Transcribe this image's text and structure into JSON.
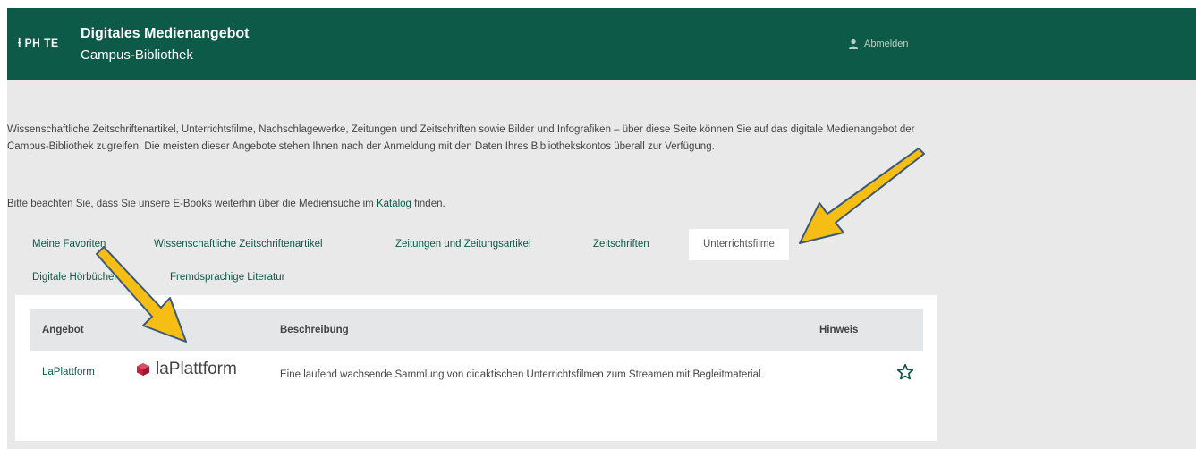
{
  "header": {
    "logo": "PH TE",
    "title": "Digitales Medienangebot",
    "subtitle": "Campus-Bibliothek",
    "logout_label": "Abmelden",
    "logout_icon": "user-icon"
  },
  "intro": {
    "text": "Wissenschaftliche Zeitschriftenartikel, Unterrichtsfilme, Nachschlagewerke, Zeitungen und Zeitschriften sowie Bilder und Infografiken – über diese Seite können Sie auf das digitale Medienangebot der Campus-Bibliothek zugreifen. Die meisten dieser Angebote stehen Ihnen nach der Anmeldung mit den Daten Ihres Bibliothekskontos überall zur Verfügung.",
    "note_before": "Bitte beachten Sie, dass Sie unsere E-Books weiterhin über die Mediensuche im ",
    "note_link": "Katalog",
    "note_after": " finden."
  },
  "tabs": {
    "favorites": "Meine Favoriten",
    "journals": "Wissenschaftliche Zeitschriftenartikel",
    "newspapers": "Zeitungen und Zeitungsartikel",
    "magazines": "Zeitschriften",
    "films": "Unterrichtsfilme",
    "audiobooks": "Digitale Hörbücher",
    "foreign": "Fremdsprachige Literatur"
  },
  "table": {
    "col_offer": "Angebot",
    "col_description": "Beschreibung",
    "col_note": "Hinweis",
    "rows": [
      {
        "offer": "LaPlattform",
        "brand": "laPlattform",
        "description": "Eine laufend wachsende Sammlung von didaktischen Unterrichtsfilmen zum Streamen mit Begleitmaterial.",
        "favorite_icon": "star-outline-icon"
      }
    ]
  },
  "colors": {
    "header_green": "#0c5a47",
    "arrow_fill": "#f6bd15",
    "arrow_outline": "#3b5a78",
    "brand_red": "#c5203e"
  }
}
